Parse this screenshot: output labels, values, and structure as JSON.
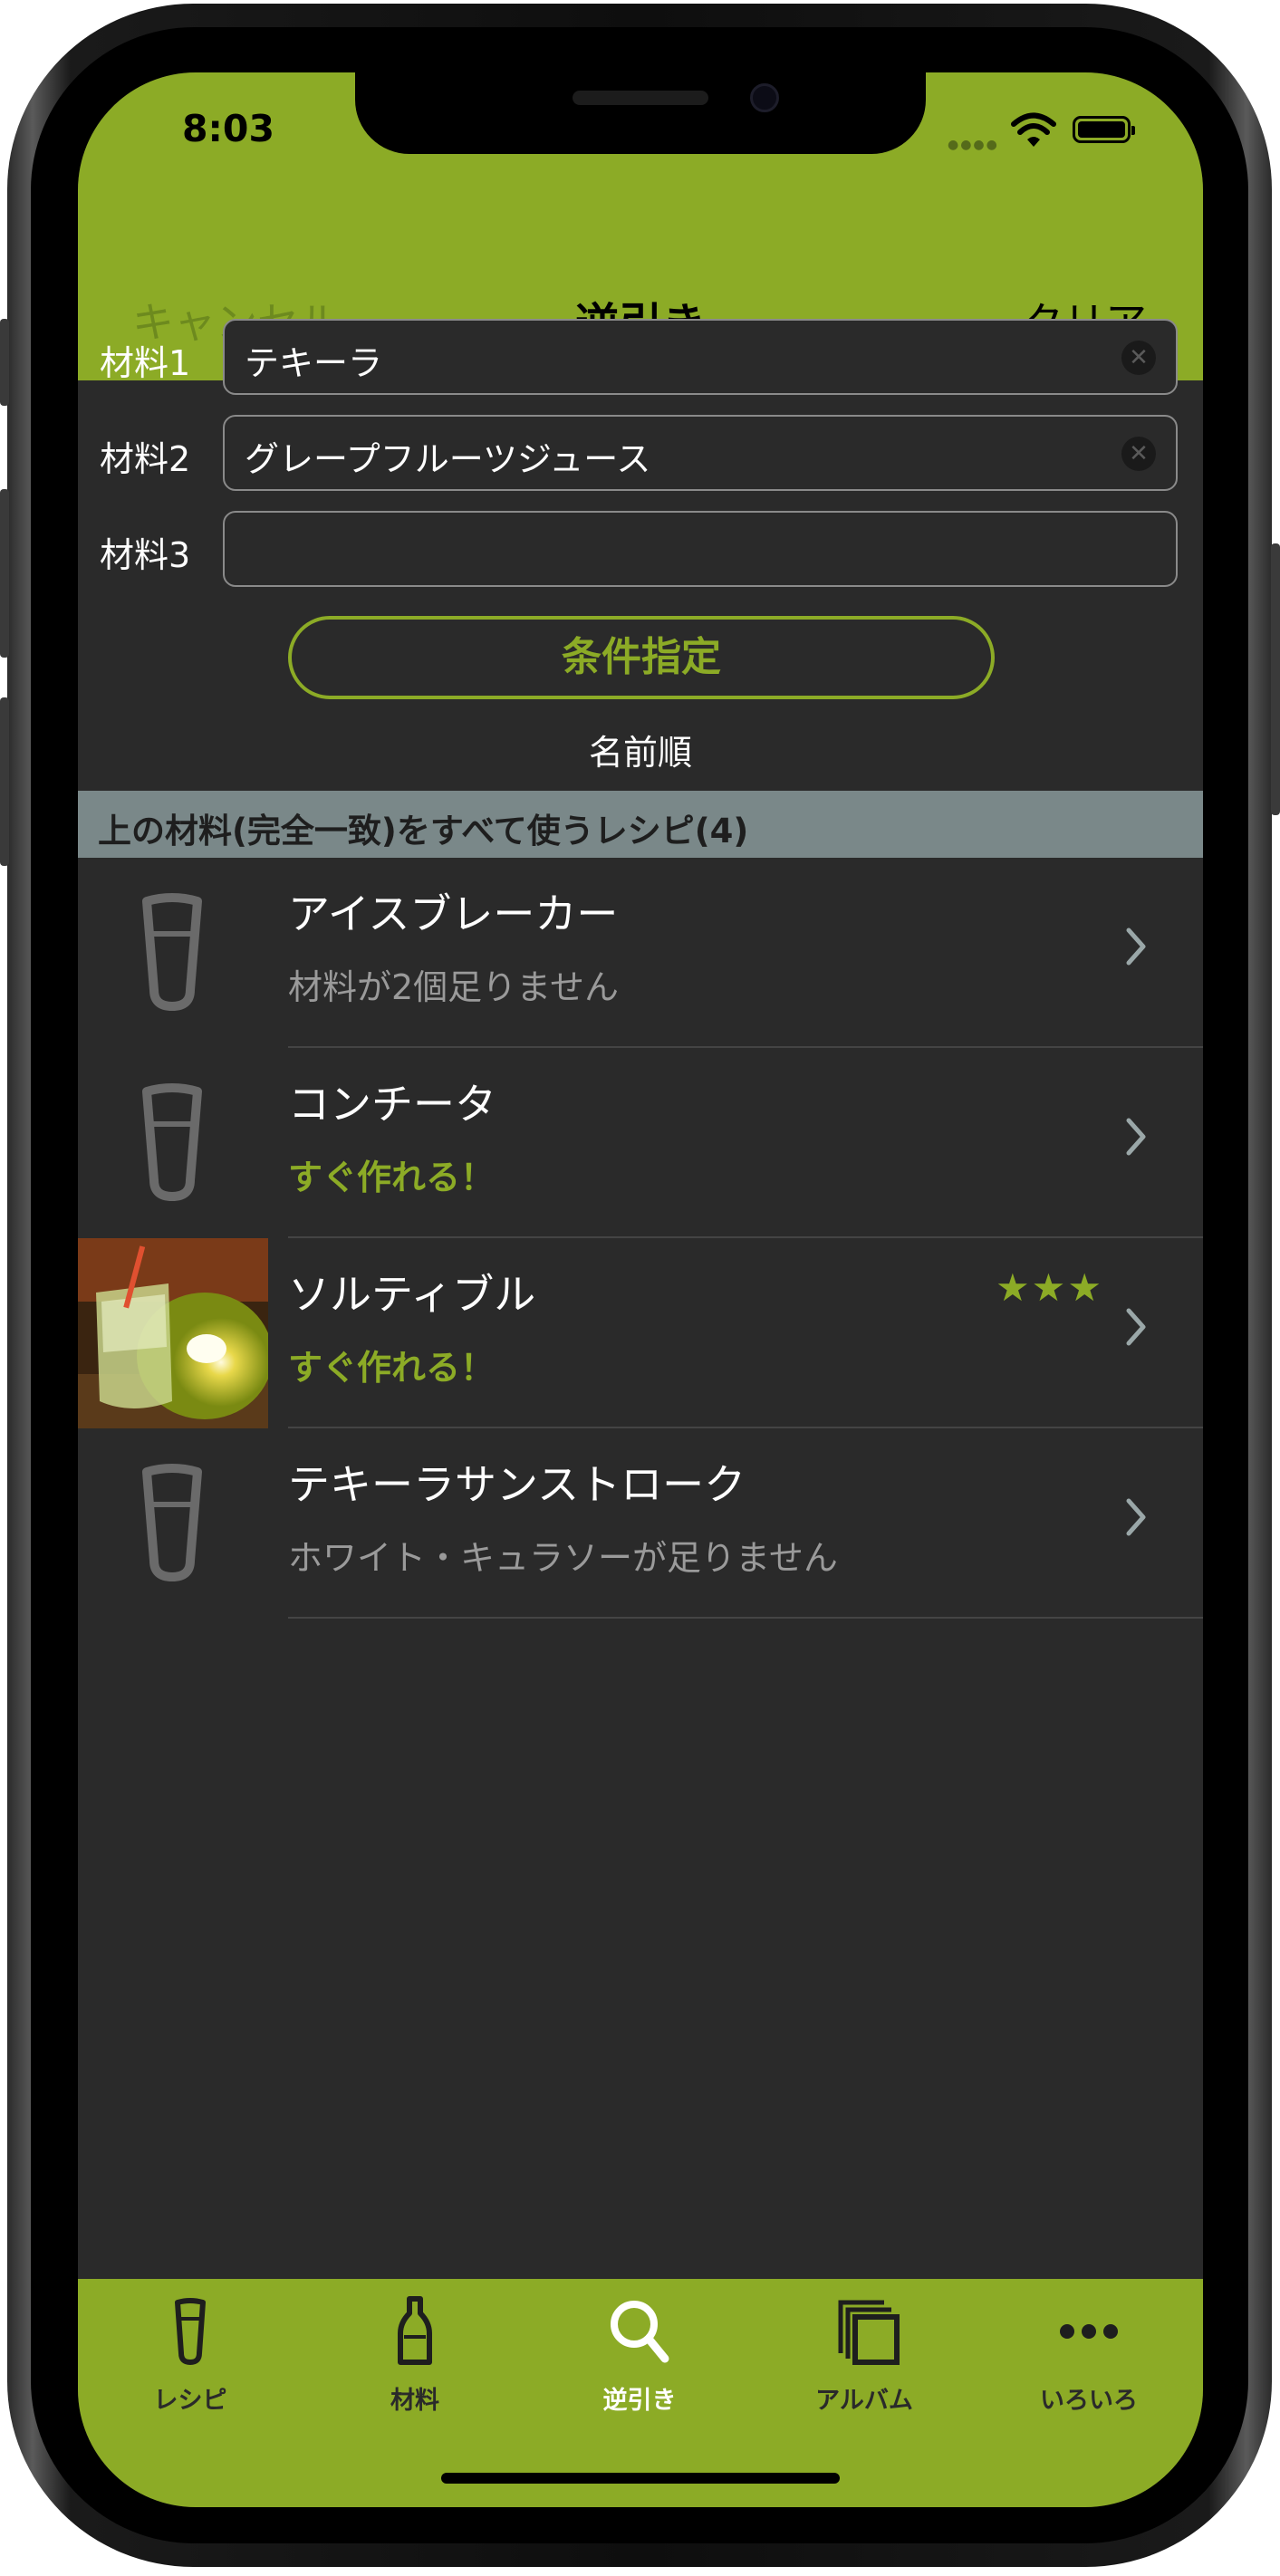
{
  "status": {
    "time": "8:03"
  },
  "nav": {
    "cancel": "キャンセル",
    "title": "逆引き",
    "clear": "クリア"
  },
  "fields": [
    {
      "label": "材料1",
      "value": "テキーラ"
    },
    {
      "label": "材料2",
      "value": "グレープフルーツジュース"
    },
    {
      "label": "材料3",
      "value": ""
    }
  ],
  "condition_button": "条件指定",
  "sort_label": "名前順",
  "section_header": "上の材料(完全一致)をすべて使うレシピ(4)",
  "recipes": [
    {
      "title": "アイスブレーカー",
      "subtitle": "材料が2個足りません",
      "status": "missing",
      "stars": ""
    },
    {
      "title": "コンチータ",
      "subtitle": "すぐ作れる！",
      "status": "ok",
      "stars": ""
    },
    {
      "title": "ソルティブル",
      "subtitle": "すぐ作れる！",
      "status": "ok",
      "stars": "★★★",
      "rating": 3
    },
    {
      "title": "テキーラサンストローク",
      "subtitle": "ホワイト・キュラソーが足りません",
      "status": "missing",
      "stars": ""
    }
  ],
  "tabs": [
    {
      "label": "レシピ",
      "icon": "glass-icon"
    },
    {
      "label": "材料",
      "icon": "bottle-icon"
    },
    {
      "label": "逆引き",
      "icon": "search-icon",
      "active": true
    },
    {
      "label": "アルバム",
      "icon": "album-icon"
    },
    {
      "label": "いろいろ",
      "icon": "more-icon"
    }
  ],
  "colors": {
    "accent": "#8cab26",
    "background": "#2a2a2a",
    "section": "#7a8889"
  }
}
